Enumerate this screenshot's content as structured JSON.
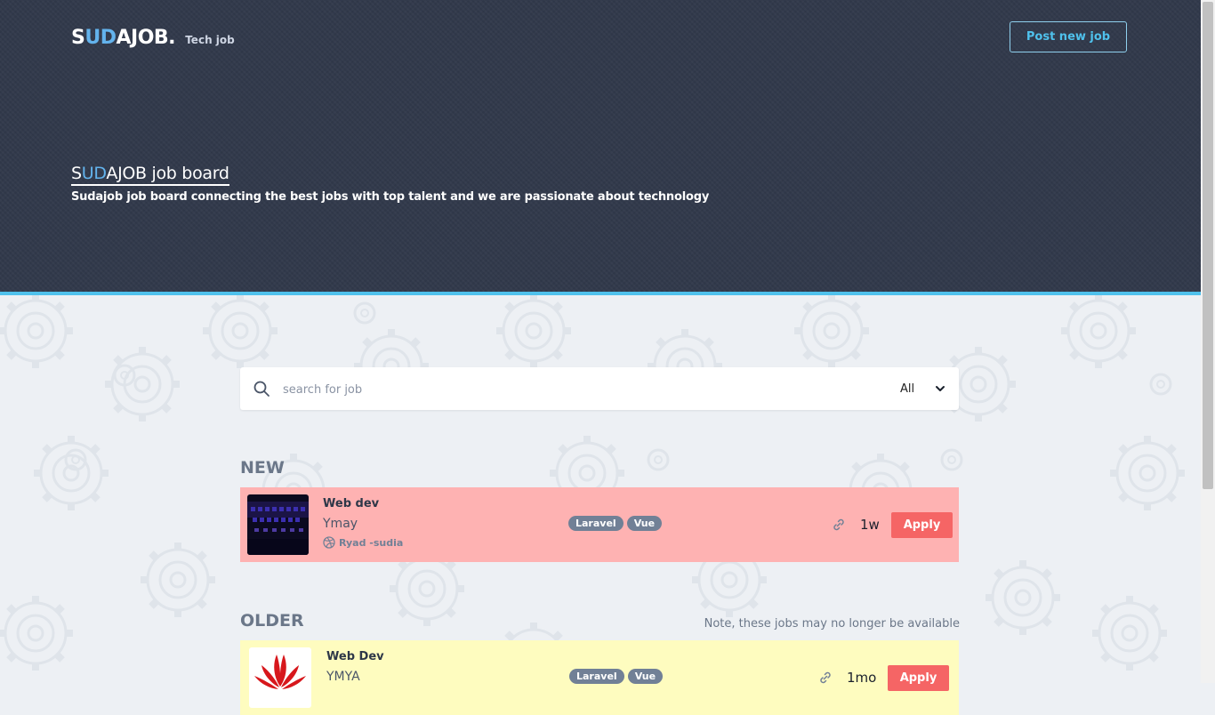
{
  "header": {
    "logo_a": "S",
    "logo_hl": "UD",
    "logo_b": "AJOB.",
    "logo_tag": "Tech job",
    "post_button": "Post new job",
    "title_a": "S",
    "title_hl": "UD",
    "title_b": "AJOB job board",
    "subtitle": "Sudajob job board connecting the best jobs with top talent and we are passionate about technology"
  },
  "search": {
    "placeholder": "search for job",
    "filter_value": "All"
  },
  "sections": {
    "new_label": "NEW",
    "older_label": "OLDER",
    "older_note": "Note, these jobs may no longer be available"
  },
  "jobs_new": [
    {
      "title": "Web dev",
      "company": "Ymay",
      "poster": "Ryad -sudia",
      "tags": [
        "Laravel",
        "Vue"
      ],
      "age": "1w",
      "apply_label": "Apply"
    }
  ],
  "jobs_old": [
    {
      "title": "Web Dev",
      "company": "YMYA",
      "tags": [
        "Laravel",
        "Vue"
      ],
      "age": "1mo",
      "apply_label": "Apply"
    }
  ],
  "colors": {
    "accent": "#4fc1ec",
    "new_job_bg": "#feb2b2",
    "old_job_bg": "#fefcbf",
    "apply": "#f56565"
  }
}
